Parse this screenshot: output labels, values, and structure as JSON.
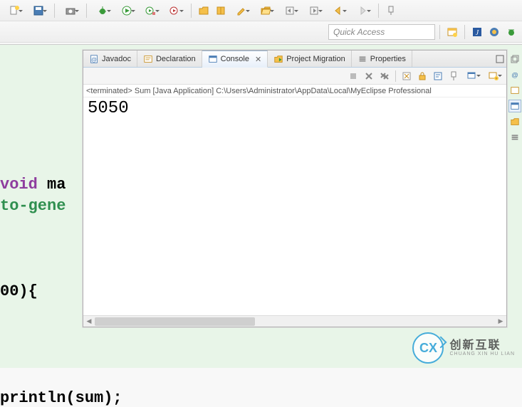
{
  "toolbar": {
    "quick_access_placeholder": "Quick Access"
  },
  "tabs": [
    {
      "label": "Javadoc",
      "icon": "javadoc-icon"
    },
    {
      "label": "Declaration",
      "icon": "declaration-icon"
    },
    {
      "label": "Console",
      "icon": "console-icon",
      "active": true,
      "closable": true
    },
    {
      "label": "Project Migration",
      "icon": "migration-icon"
    },
    {
      "label": "Properties",
      "icon": "properties-icon"
    }
  ],
  "console": {
    "status": "<terminated> Sum [Java Application] C:\\Users\\Administrator\\AppData\\Local\\MyEclipse Professional",
    "output": "5050"
  },
  "code_fragments": {
    "void_line": "void ma",
    "gene_line": "to-gene",
    "brace_line": "00){",
    "println_line": "println(sum);"
  },
  "watermark": {
    "logo_letters": "CX",
    "main": "创新互联",
    "sub": "CHUANG XIN HU LIAN"
  }
}
